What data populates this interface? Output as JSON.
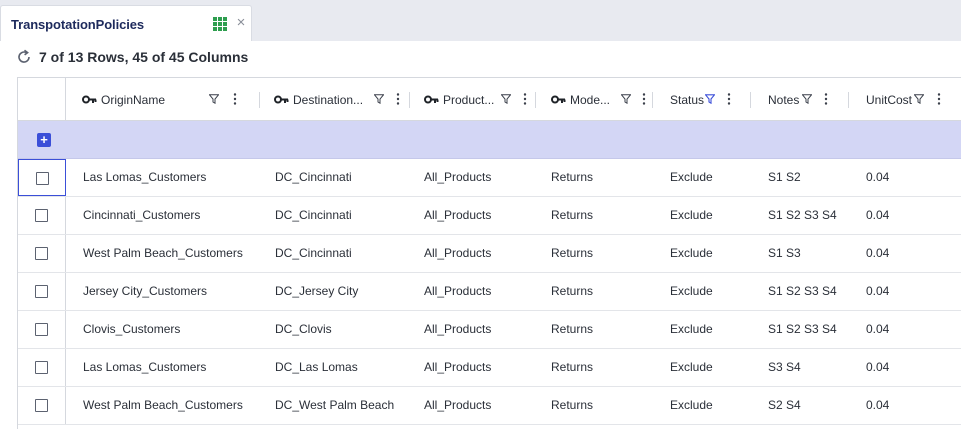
{
  "tab": {
    "title": "TranspotationPolicies",
    "icon": "grid-table-icon",
    "close_glyph": "×"
  },
  "status": {
    "row_count_text": "7 of 13 Rows, 45 of 45 Columns"
  },
  "add_row": {
    "label": "+"
  },
  "columns": [
    {
      "label": "OriginName",
      "key": true
    },
    {
      "label": "Destination...",
      "key": true
    },
    {
      "label": "Product...",
      "key": true
    },
    {
      "label": "Mode...",
      "key": true
    },
    {
      "label": "Status",
      "key": false,
      "filter_active": true
    },
    {
      "label": "Notes",
      "key": false
    },
    {
      "label": "UnitCost",
      "key": false
    }
  ],
  "rows": [
    [
      "Las Lomas_Customers",
      "DC_Cincinnati",
      "All_Products",
      "Returns",
      "Exclude",
      "S1 S2",
      "0.04"
    ],
    [
      "Cincinnati_Customers",
      "DC_Cincinnati",
      "All_Products",
      "Returns",
      "Exclude",
      "S1 S2 S3 S4",
      "0.04"
    ],
    [
      "West Palm Beach_Customers",
      "DC_Cincinnati",
      "All_Products",
      "Returns",
      "Exclude",
      "S1 S3",
      "0.04"
    ],
    [
      "Jersey City_Customers",
      "DC_Jersey City",
      "All_Products",
      "Returns",
      "Exclude",
      "S1 S2 S3 S4",
      "0.04"
    ],
    [
      "Clovis_Customers",
      "DC_Clovis",
      "All_Products",
      "Returns",
      "Exclude",
      "S1 S2 S3 S4",
      "0.04"
    ],
    [
      "Las Lomas_Customers",
      "DC_Las Lomas",
      "All_Products",
      "Returns",
      "Exclude",
      "S3 S4",
      "0.04"
    ],
    [
      "West Palm Beach_Customers",
      "DC_West Palm Beach",
      "All_Products",
      "Returns",
      "Exclude",
      "S2 S4",
      "0.04"
    ]
  ],
  "colors": {
    "accent": "#3b4fd8",
    "add_row_bg": "#d3d6f5",
    "tab_title": "#1d2a5c",
    "grid_icon": "#2e9e4f"
  }
}
